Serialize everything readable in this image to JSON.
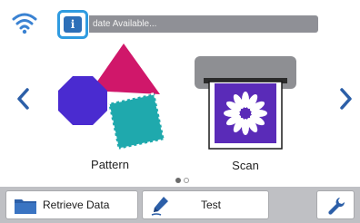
{
  "status": {
    "update_text": "date Available..."
  },
  "carousel": {
    "items": [
      {
        "label": "Pattern",
        "icon": "shapes-icon"
      },
      {
        "label": "Scan",
        "icon": "scanner-icon"
      }
    ],
    "page_indicator": {
      "current": 1,
      "total": 2
    }
  },
  "bottom_bar": {
    "retrieve_label": "Retrieve Data",
    "test_label": "Test"
  },
  "colors": {
    "accent_blue": "#2d6fb8",
    "info_border": "#2f9be0",
    "shape_magenta": "#d0176a",
    "shape_purple": "#4a2bd0",
    "shape_teal": "#1fa9ad",
    "status_bar_gray": "#8f9096",
    "bottom_bar_gray": "#bfc0c4"
  }
}
